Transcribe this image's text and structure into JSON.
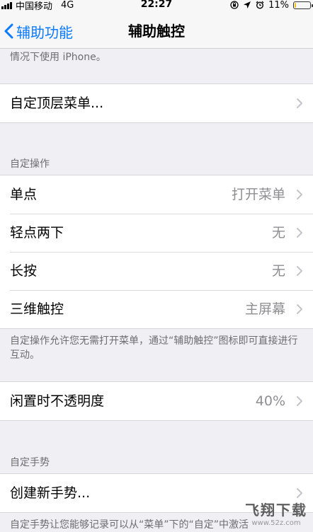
{
  "status_bar": {
    "carrier": "中国移动",
    "network": "4G",
    "time": "22:27",
    "battery": "11%",
    "battery_level": 0.11,
    "battery_color": "#f0c419"
  },
  "nav": {
    "back_label": "辅助功能",
    "title": "辅助触控",
    "accent_color": "#0a7aff"
  },
  "top_text": "情况下使用 iPhone。",
  "custom_menu": {
    "label": "自定顶层菜单..."
  },
  "custom_actions": {
    "header": "自定操作",
    "rows": [
      {
        "label": "单点",
        "value": "打开菜单"
      },
      {
        "label": "轻点两下",
        "value": "无"
      },
      {
        "label": "长按",
        "value": "无"
      },
      {
        "label": "三维触控",
        "value": "主屏幕"
      }
    ],
    "footer": "自定操作允许您无需打开菜单，通过“辅助触控”图标即可直接进行互动。"
  },
  "idle_opacity": {
    "label": "闲置时不透明度",
    "value": "40%"
  },
  "custom_gestures": {
    "header": "自定手势",
    "create_label": "创建新手势...",
    "footer": "自定手势让您能够记录可以从“菜单”下的“自定”中激活"
  },
  "watermark": {
    "main": "飞翔下载",
    "sub": "www.52z.com"
  }
}
